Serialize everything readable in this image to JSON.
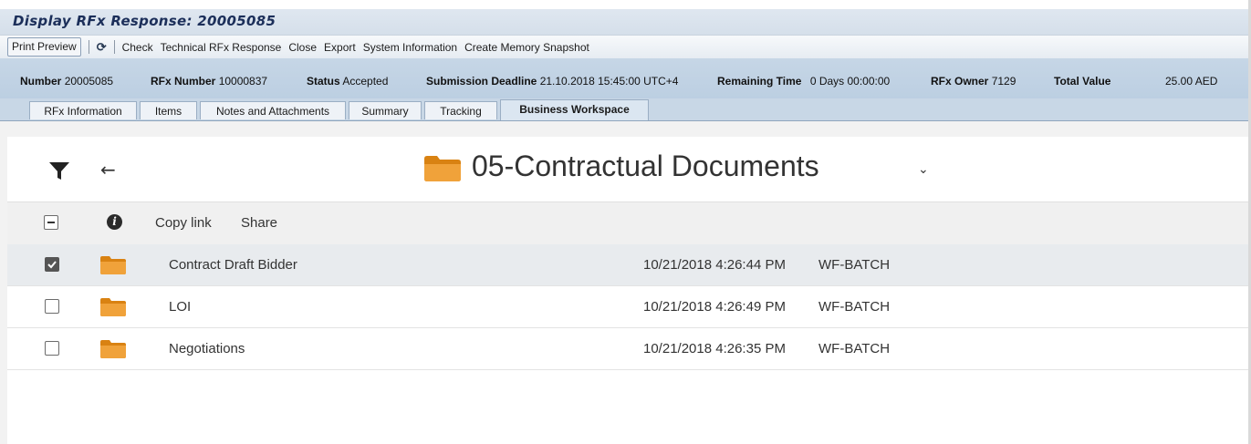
{
  "window": {
    "title": "Display RFx Response: 20005085"
  },
  "toolbar": {
    "print_preview": "Print Preview",
    "refresh_icon": "refresh-icon",
    "items": [
      "Check",
      "Technical RFx Response",
      "Close",
      "Export",
      "System Information",
      "Create Memory Snapshot"
    ]
  },
  "header": {
    "number_label": "Number",
    "number_value": "20005085",
    "rfx_number_label": "RFx Number",
    "rfx_number_value": "10000837",
    "status_label": "Status",
    "status_value": "Accepted",
    "deadline_label": "Submission Deadline",
    "deadline_value": "21.10.2018 15:45:00 UTC+4",
    "remaining_label": "Remaining Time",
    "remaining_value": "0 Days 00:00:00",
    "owner_label": "RFx Owner",
    "owner_value": "7129",
    "total_label": "Total Value",
    "total_value": "25.00 AED"
  },
  "tabs": [
    {
      "label": "RFx Information"
    },
    {
      "label": "Items"
    },
    {
      "label": "Notes and Attachments"
    },
    {
      "label": "Summary"
    },
    {
      "label": "Tracking"
    },
    {
      "label": "Business Workspace",
      "active": true
    }
  ],
  "workspace": {
    "folder_title": "05-Contractual Documents",
    "actions": {
      "copy_link": "Copy link",
      "share": "Share"
    },
    "rows": [
      {
        "name": "Contract Draft Bidder",
        "date": "10/21/2018 4:26:44 PM",
        "user": "WF-BATCH",
        "checked": true
      },
      {
        "name": "LOI",
        "date": "10/21/2018 4:26:49 PM",
        "user": "WF-BATCH",
        "checked": false
      },
      {
        "name": "Negotiations",
        "date": "10/21/2018 4:26:35 PM",
        "user": "WF-BATCH",
        "checked": false
      }
    ]
  },
  "colors": {
    "folder": "#e8911c",
    "accent": "#1c2f5a",
    "selected_row": "#e8ebee"
  }
}
